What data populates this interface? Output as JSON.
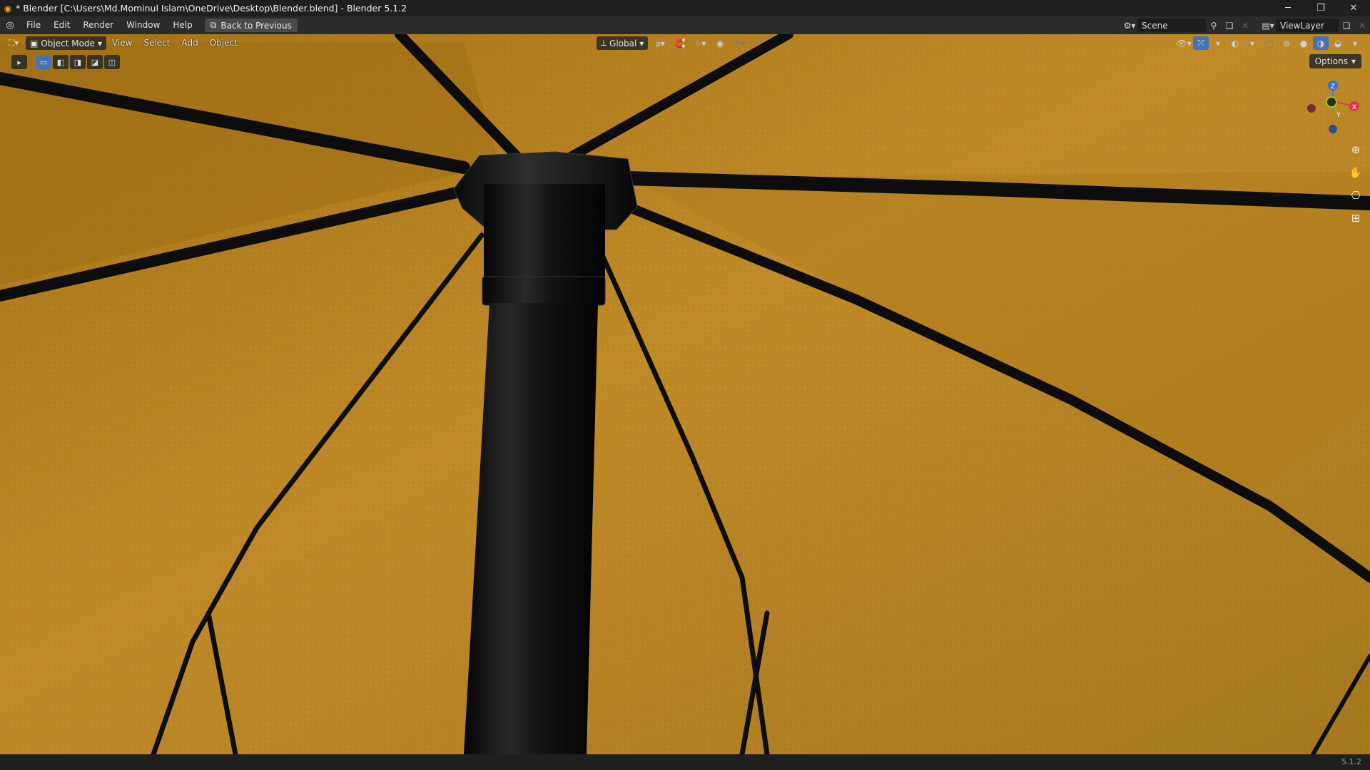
{
  "titlebar": {
    "title": "* Blender [C:\\Users\\Md.Mominul Islam\\OneDrive\\Desktop\\Blender.blend] - Blender 5.1.2",
    "minimize": "─",
    "maximize": "❐",
    "close": "✕"
  },
  "menubar": {
    "items": [
      "File",
      "Edit",
      "Render",
      "Window",
      "Help"
    ],
    "back_label": "Back to Previous",
    "scene_label": "Scene",
    "viewlayer_label": "ViewLayer"
  },
  "viewport_header": {
    "mode_label": "Object Mode",
    "menus": [
      "View",
      "Select",
      "Add",
      "Object"
    ],
    "transform_orientation": "Global",
    "options_label": "Options"
  },
  "gizmo": {
    "z": "Z",
    "y": "Y",
    "x": "X"
  },
  "status": {
    "version": "5.1.2"
  },
  "colors": {
    "canvas": "#b07f1f",
    "frame": "#0e0e0e",
    "accent": "#4772b3"
  }
}
